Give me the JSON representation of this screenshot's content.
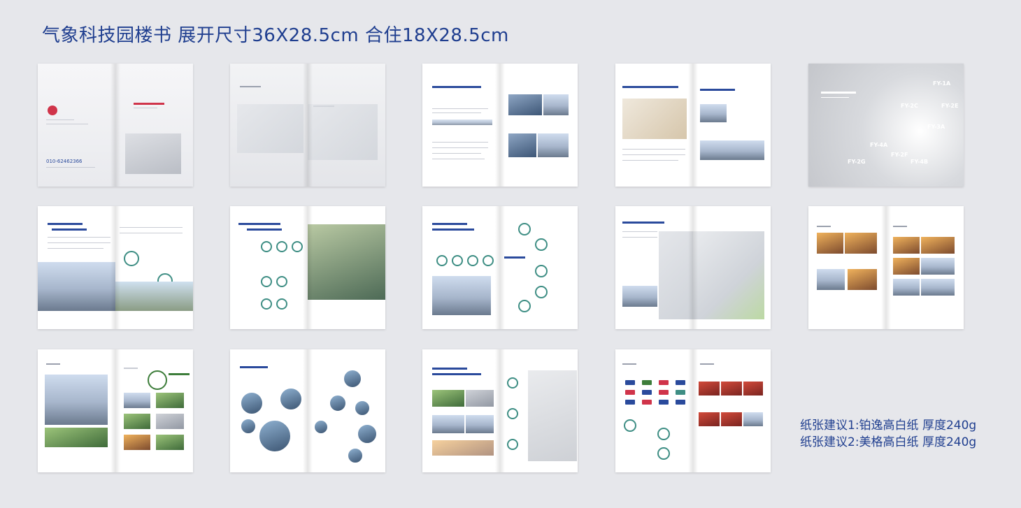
{
  "heading": "气象科技园楼书 展开尺寸36X28.5cm  合住18X28.5cm",
  "paper": {
    "suggestion1": "纸张建议1:铂逸高白纸     厚度240g",
    "suggestion2": "纸张建议2:美格高白纸     厚度240g"
  },
  "satellite_labels": [
    "FY-1A",
    "FY-2C",
    "FY-2E",
    "FY-3A",
    "FY-4A",
    "FY-2F",
    "FY-2G",
    "FY-4B"
  ],
  "cover_phone": "010-62462366",
  "colors": {
    "title_blue": "#1f3e8f",
    "accent_red": "#d0344a",
    "accent_teal": "#3e8e84",
    "background": "#e6e7eb"
  }
}
